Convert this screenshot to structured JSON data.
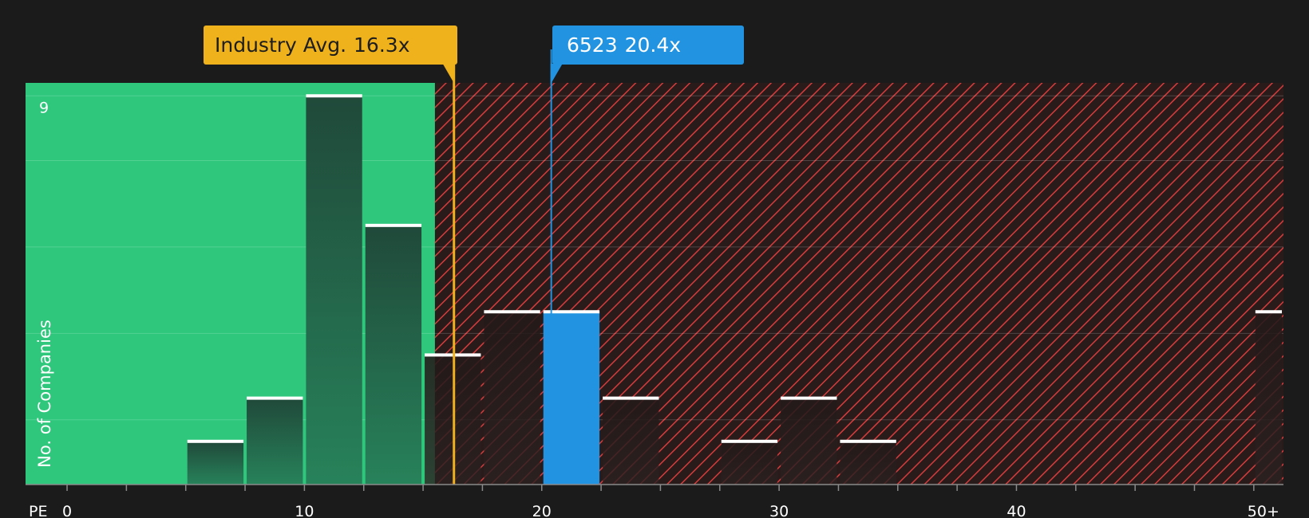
{
  "chart_data": {
    "type": "bar",
    "x_label": "PE",
    "y_label": "No. of Companies",
    "x_ticks": [
      "0",
      "10",
      "20",
      "30",
      "40",
      "50+"
    ],
    "x_tick_values": [
      0,
      10,
      20,
      30,
      40,
      50
    ],
    "x_range": [
      -1.75,
      51.25
    ],
    "y_range": [
      0,
      9.3
    ],
    "y_tick_labels": [
      {
        "value": 9,
        "label": "9"
      }
    ],
    "bin_width": 2.5,
    "bars": [
      {
        "x0": 5,
        "x1": 7.5,
        "count": 1
      },
      {
        "x0": 7.5,
        "x1": 10,
        "count": 2
      },
      {
        "x0": 10,
        "x1": 12.5,
        "count": 9
      },
      {
        "x0": 12.5,
        "x1": 15,
        "count": 6
      },
      {
        "x0": 15,
        "x1": 17.5,
        "count": 3
      },
      {
        "x0": 17.5,
        "x1": 20,
        "count": 4
      },
      {
        "x0": 20,
        "x1": 22.5,
        "count": 4,
        "highlight": true
      },
      {
        "x0": 22.5,
        "x1": 25,
        "count": 2
      },
      {
        "x0": 27.5,
        "x1": 30,
        "count": 1
      },
      {
        "x0": 30,
        "x1": 32.5,
        "count": 2
      },
      {
        "x0": 32.5,
        "x1": 35,
        "count": 1
      },
      {
        "x0": 50,
        "x1": 51.25,
        "count": 4
      }
    ],
    "green_zone_end": 15.5,
    "industry_avg": {
      "label": "Industry Avg.",
      "value_text": "16.3x",
      "value": 16.3
    },
    "company": {
      "label": "6523",
      "value_text": "20.4x",
      "value": 20.4
    },
    "grid": true,
    "colors": {
      "background": "#1b1b1b",
      "green_zone": "#2ec77c",
      "red_hatch": "#d63c3c",
      "industry": "#f0b21c",
      "company": "#2293e0",
      "bar_dark": "#1f4a37",
      "text": "#ffffff"
    }
  }
}
